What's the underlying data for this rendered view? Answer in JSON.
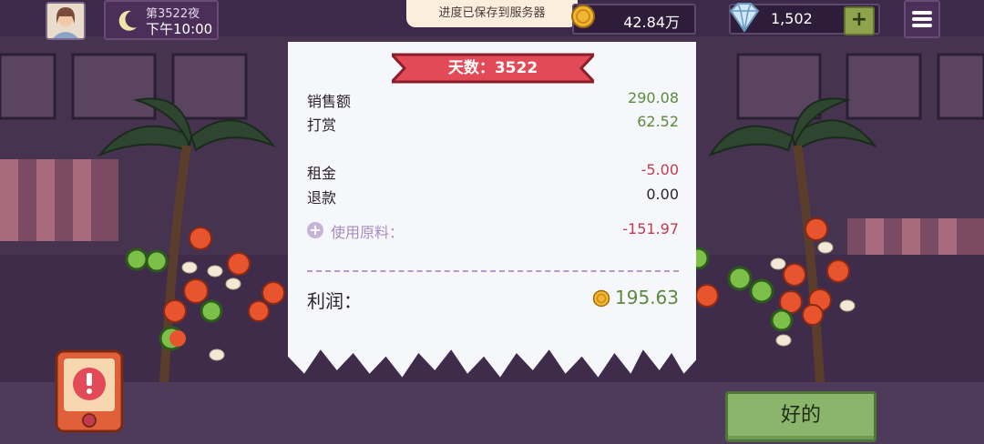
{
  "hud": {
    "night_label": "第3522夜",
    "time_label": "下午10:00",
    "save_toast": "进度已保存到服务器",
    "coins": "42.84万",
    "gems": "1,502",
    "add_gems_label": "+"
  },
  "receipt": {
    "title": "天数：3522",
    "rows": [
      {
        "label": "销售额",
        "amount": "290.08"
      },
      {
        "label": "打赏",
        "amount": "62.52"
      },
      {
        "label": "租金",
        "amount": "-5.00"
      },
      {
        "label": "退款",
        "amount": "0.00"
      },
      {
        "label": "使用原料：",
        "amount": "-151.97"
      }
    ],
    "profit_label": "利润：",
    "profit_amount": "195.63"
  },
  "ok_button": "好的",
  "colors": {
    "positive": "#5b8a3c",
    "negative": "#c23b4e",
    "ribbon": "#e24a57",
    "button": "#8ab56a"
  }
}
